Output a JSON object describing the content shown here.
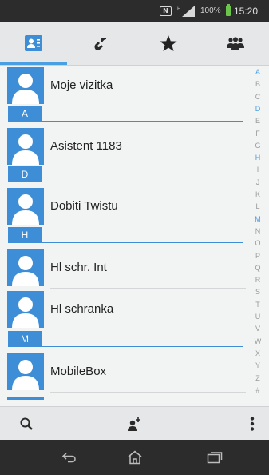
{
  "status_bar": {
    "nfc_glyph": "N",
    "battery_percent": "100%",
    "time": "15:20",
    "icons": [
      "nfc-icon",
      "signal-icon",
      "battery-icon"
    ]
  },
  "tabs": [
    {
      "name": "contacts",
      "icon": "contact-card-icon",
      "active": true
    },
    {
      "name": "calls",
      "icon": "phone-icon",
      "active": false
    },
    {
      "name": "favorites",
      "icon": "star-icon",
      "active": false
    },
    {
      "name": "groups",
      "icon": "group-icon",
      "active": false
    }
  ],
  "contacts": {
    "profile": "Moje vizitka",
    "sections": [
      {
        "letter": "A",
        "entries": [
          "Asistent 1183"
        ]
      },
      {
        "letter": "D",
        "entries": [
          "Dobiti Twistu"
        ]
      },
      {
        "letter": "H",
        "entries": [
          "Hl schr. Int",
          "Hl schranka"
        ]
      },
      {
        "letter": "M",
        "entries": [
          "MobileBox"
        ]
      }
    ]
  },
  "alphabet": [
    "A",
    "B",
    "C",
    "D",
    "E",
    "F",
    "G",
    "H",
    "I",
    "J",
    "K",
    "L",
    "M",
    "N",
    "O",
    "P",
    "Q",
    "R",
    "S",
    "T",
    "U",
    "V",
    "W",
    "X",
    "Y",
    "Z",
    "#"
  ],
  "alphabet_highlighted": [
    "A",
    "D",
    "H",
    "M"
  ],
  "actions": {
    "search": "search-icon",
    "add_contact": "add-contact-icon",
    "overflow": "overflow-menu-icon"
  },
  "nav": [
    "back-icon",
    "home-icon",
    "recent-apps-icon"
  ],
  "colors": {
    "accent": "#3d8ed6",
    "highlight_letter": "#4a9ee2",
    "status_bar": "#2c2c2c",
    "battery": "#6cc54a"
  }
}
